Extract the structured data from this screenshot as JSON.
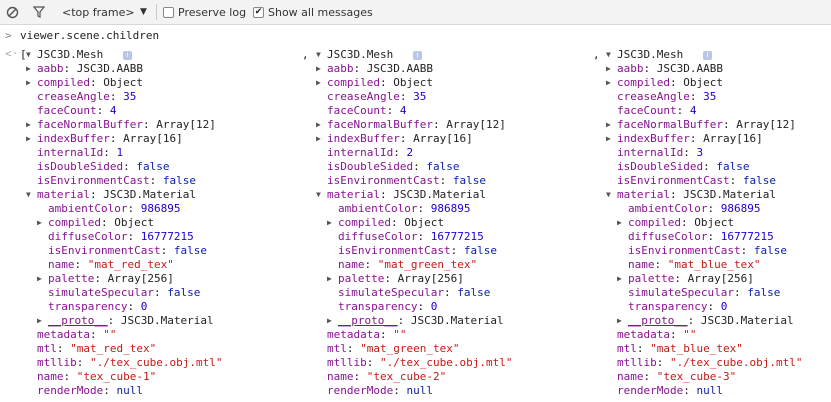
{
  "toolbar": {
    "frame_label": "<top frame>",
    "preserve_log_label": "Preserve log",
    "preserve_log_checked": false,
    "show_all_label": "Show all messages",
    "show_all_checked": true
  },
  "console": {
    "command": "viewer.scene.children",
    "open_bracket": "[",
    "separator": ","
  },
  "meshes": [
    {
      "type": "JSC3D.Mesh",
      "rows": [
        {
          "key": "aabb",
          "value": "JSC3D.AABB",
          "vtype": "o",
          "expander": "right"
        },
        {
          "key": "compiled",
          "value": "Object",
          "vtype": "o",
          "expander": "right"
        },
        {
          "key": "creaseAngle",
          "value": "35",
          "vtype": "n"
        },
        {
          "key": "faceCount",
          "value": "4",
          "vtype": "n"
        },
        {
          "key": "faceNormalBuffer",
          "value": "Array[12]",
          "vtype": "o",
          "expander": "right"
        },
        {
          "key": "indexBuffer",
          "value": "Array[16]",
          "vtype": "o",
          "expander": "right"
        },
        {
          "key": "internalId",
          "value": "1",
          "vtype": "n"
        },
        {
          "key": "isDoubleSided",
          "value": "false",
          "vtype": "kw"
        },
        {
          "key": "isEnvironmentCast",
          "value": "false",
          "vtype": "kw"
        },
        {
          "key": "material",
          "value": "JSC3D.Material",
          "vtype": "o",
          "expander": "down"
        },
        {
          "key": "ambientColor",
          "value": "986895",
          "vtype": "n",
          "indent": 1
        },
        {
          "key": "compiled",
          "value": "Object",
          "vtype": "o",
          "expander": "right",
          "indent": 1
        },
        {
          "key": "diffuseColor",
          "value": "16777215",
          "vtype": "n",
          "indent": 1
        },
        {
          "key": "isEnvironmentCast",
          "value": "false",
          "vtype": "kw",
          "indent": 1
        },
        {
          "key": "name",
          "value": "\"mat_red_tex\"",
          "vtype": "s",
          "indent": 1
        },
        {
          "key": "palette",
          "value": "Array[256]",
          "vtype": "o",
          "expander": "right",
          "indent": 1
        },
        {
          "key": "simulateSpecular",
          "value": "false",
          "vtype": "kw",
          "indent": 1
        },
        {
          "key": "transparency",
          "value": "0",
          "vtype": "n",
          "indent": 1
        },
        {
          "key": "__proto__",
          "value": "JSC3D.Material",
          "vtype": "o",
          "expander": "right",
          "indent": 1,
          "proto": true
        },
        {
          "key": "metadata",
          "value": "\"\"",
          "vtype": "s"
        },
        {
          "key": "mtl",
          "value": "\"mat_red_tex\"",
          "vtype": "s"
        },
        {
          "key": "mtllib",
          "value": "\"./tex_cube.obj.mtl\"",
          "vtype": "s"
        },
        {
          "key": "name",
          "value": "\"tex_cube-1\"",
          "vtype": "s"
        },
        {
          "key": "renderMode",
          "value": "null",
          "vtype": "kw"
        }
      ]
    },
    {
      "type": "JSC3D.Mesh",
      "rows": [
        {
          "key": "aabb",
          "value": "JSC3D.AABB",
          "vtype": "o",
          "expander": "right"
        },
        {
          "key": "compiled",
          "value": "Object",
          "vtype": "o",
          "expander": "right"
        },
        {
          "key": "creaseAngle",
          "value": "35",
          "vtype": "n"
        },
        {
          "key": "faceCount",
          "value": "4",
          "vtype": "n"
        },
        {
          "key": "faceNormalBuffer",
          "value": "Array[12]",
          "vtype": "o",
          "expander": "right"
        },
        {
          "key": "indexBuffer",
          "value": "Array[16]",
          "vtype": "o",
          "expander": "right"
        },
        {
          "key": "internalId",
          "value": "2",
          "vtype": "n"
        },
        {
          "key": "isDoubleSided",
          "value": "false",
          "vtype": "kw"
        },
        {
          "key": "isEnvironmentCast",
          "value": "false",
          "vtype": "kw"
        },
        {
          "key": "material",
          "value": "JSC3D.Material",
          "vtype": "o",
          "expander": "down"
        },
        {
          "key": "ambientColor",
          "value": "986895",
          "vtype": "n",
          "indent": 1
        },
        {
          "key": "compiled",
          "value": "Object",
          "vtype": "o",
          "expander": "right",
          "indent": 1
        },
        {
          "key": "diffuseColor",
          "value": "16777215",
          "vtype": "n",
          "indent": 1
        },
        {
          "key": "isEnvironmentCast",
          "value": "false",
          "vtype": "kw",
          "indent": 1
        },
        {
          "key": "name",
          "value": "\"mat_green_tex\"",
          "vtype": "s",
          "indent": 1
        },
        {
          "key": "palette",
          "value": "Array[256]",
          "vtype": "o",
          "expander": "right",
          "indent": 1
        },
        {
          "key": "simulateSpecular",
          "value": "false",
          "vtype": "kw",
          "indent": 1
        },
        {
          "key": "transparency",
          "value": "0",
          "vtype": "n",
          "indent": 1
        },
        {
          "key": "__proto__",
          "value": "JSC3D.Material",
          "vtype": "o",
          "expander": "right",
          "indent": 1,
          "proto": true
        },
        {
          "key": "metadata",
          "value": "\"\"",
          "vtype": "s"
        },
        {
          "key": "mtl",
          "value": "\"mat_green_tex\"",
          "vtype": "s"
        },
        {
          "key": "mtllib",
          "value": "\"./tex_cube.obj.mtl\"",
          "vtype": "s"
        },
        {
          "key": "name",
          "value": "\"tex_cube-2\"",
          "vtype": "s"
        },
        {
          "key": "renderMode",
          "value": "null",
          "vtype": "kw"
        }
      ]
    },
    {
      "type": "JSC3D.Mesh",
      "rows": [
        {
          "key": "aabb",
          "value": "JSC3D.AABB",
          "vtype": "o",
          "expander": "right"
        },
        {
          "key": "compiled",
          "value": "Object",
          "vtype": "o",
          "expander": "right"
        },
        {
          "key": "creaseAngle",
          "value": "35",
          "vtype": "n"
        },
        {
          "key": "faceCount",
          "value": "4",
          "vtype": "n"
        },
        {
          "key": "faceNormalBuffer",
          "value": "Array[12]",
          "vtype": "o",
          "expander": "right"
        },
        {
          "key": "indexBuffer",
          "value": "Array[16]",
          "vtype": "o",
          "expander": "right"
        },
        {
          "key": "internalId",
          "value": "3",
          "vtype": "n"
        },
        {
          "key": "isDoubleSided",
          "value": "false",
          "vtype": "kw"
        },
        {
          "key": "isEnvironmentCast",
          "value": "false",
          "vtype": "kw"
        },
        {
          "key": "material",
          "value": "JSC3D.Material",
          "vtype": "o",
          "expander": "down"
        },
        {
          "key": "ambientColor",
          "value": "986895",
          "vtype": "n",
          "indent": 1
        },
        {
          "key": "compiled",
          "value": "Object",
          "vtype": "o",
          "expander": "right",
          "indent": 1
        },
        {
          "key": "diffuseColor",
          "value": "16777215",
          "vtype": "n",
          "indent": 1
        },
        {
          "key": "isEnvironmentCast",
          "value": "false",
          "vtype": "kw",
          "indent": 1
        },
        {
          "key": "name",
          "value": "\"mat_blue_tex\"",
          "vtype": "s",
          "indent": 1
        },
        {
          "key": "palette",
          "value": "Array[256]",
          "vtype": "o",
          "expander": "right",
          "indent": 1
        },
        {
          "key": "simulateSpecular",
          "value": "false",
          "vtype": "kw",
          "indent": 1
        },
        {
          "key": "transparency",
          "value": "0",
          "vtype": "n",
          "indent": 1
        },
        {
          "key": "__proto__",
          "value": "JSC3D.Material",
          "vtype": "o",
          "expander": "right",
          "indent": 1,
          "proto": true
        },
        {
          "key": "metadata",
          "value": "\"\"",
          "vtype": "s"
        },
        {
          "key": "mtl",
          "value": "\"mat_blue_tex\"",
          "vtype": "s"
        },
        {
          "key": "mtllib",
          "value": "\"./tex_cube.obj.mtl\"",
          "vtype": "s"
        },
        {
          "key": "name",
          "value": "\"tex_cube-3\"",
          "vtype": "s"
        },
        {
          "key": "renderMode",
          "value": "null",
          "vtype": "kw"
        }
      ]
    }
  ]
}
